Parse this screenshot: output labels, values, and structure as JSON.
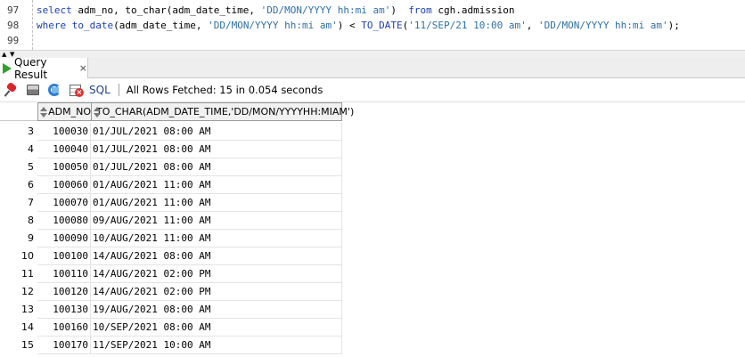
{
  "editor": {
    "lines": [
      {
        "num": "97",
        "parts": [
          {
            "t": "select",
            "c": "kw"
          },
          {
            "t": " adm_no, to_char(adm_date_time, ",
            "c": ""
          },
          {
            "t": "'DD/MON/YYYY hh:mi am'",
            "c": "str"
          },
          {
            "t": ")  ",
            "c": ""
          },
          {
            "t": "from",
            "c": "kw"
          },
          {
            "t": " cgh.admission",
            "c": ""
          }
        ]
      },
      {
        "num": "98",
        "parts": [
          {
            "t": "where",
            "c": "kw"
          },
          {
            "t": " ",
            "c": ""
          },
          {
            "t": "to_date",
            "c": "kw"
          },
          {
            "t": "(adm_date_time, ",
            "c": ""
          },
          {
            "t": "'DD/MON/YYYY hh:mi am'",
            "c": "str"
          },
          {
            "t": ") < ",
            "c": ""
          },
          {
            "t": "TO_DATE",
            "c": "kw"
          },
          {
            "t": "(",
            "c": ""
          },
          {
            "t": "'11/SEP/21 10:00 am'",
            "c": "str"
          },
          {
            "t": ", ",
            "c": ""
          },
          {
            "t": "'DD/MON/YYYY hh:mi am'",
            "c": "str"
          },
          {
            "t": ");",
            "c": ""
          }
        ]
      },
      {
        "num": "99",
        "parts": []
      }
    ]
  },
  "result_tab": {
    "label": "Query Result",
    "close": "×"
  },
  "toolbar": {
    "sql_label": "SQL",
    "status": "All Rows Fetched: 15 in 0.054 seconds"
  },
  "grid": {
    "columns": [
      "ADM_NO",
      "TO_CHAR(ADM_DATE_TIME,'DD/MON/YYYYHH:MIAM')"
    ],
    "rows": [
      {
        "n": "3",
        "adm_no": "100030",
        "date": "01/JUL/2021 08:00 AM"
      },
      {
        "n": "4",
        "adm_no": "100040",
        "date": "01/JUL/2021 08:00 AM"
      },
      {
        "n": "5",
        "adm_no": "100050",
        "date": "01/JUL/2021 08:00 AM"
      },
      {
        "n": "6",
        "adm_no": "100060",
        "date": "01/AUG/2021 11:00 AM"
      },
      {
        "n": "7",
        "adm_no": "100070",
        "date": "01/AUG/2021 11:00 AM"
      },
      {
        "n": "8",
        "adm_no": "100080",
        "date": "09/AUG/2021 11:00 AM"
      },
      {
        "n": "9",
        "adm_no": "100090",
        "date": "10/AUG/2021 11:00 AM"
      },
      {
        "n": "10",
        "adm_no": "100100",
        "date": "14/AUG/2021 08:00 AM"
      },
      {
        "n": "11",
        "adm_no": "100110",
        "date": "14/AUG/2021 02:00 PM"
      },
      {
        "n": "12",
        "adm_no": "100120",
        "date": "14/AUG/2021 02:00 PM"
      },
      {
        "n": "13",
        "adm_no": "100130",
        "date": "19/AUG/2021 08:00 AM"
      },
      {
        "n": "14",
        "adm_no": "100160",
        "date": "10/SEP/2021 08:00 AM"
      },
      {
        "n": "15",
        "adm_no": "100170",
        "date": "11/SEP/2021 10:00 AM"
      }
    ]
  },
  "colors": {
    "keyword": "#1b3fb8",
    "string": "#2f6fa8",
    "run_icon": "#2fa12f"
  },
  "icons": [
    "pin-icon",
    "print-icon",
    "refresh-icon",
    "clear-sheet-icon",
    "run-icon",
    "close-icon"
  ]
}
